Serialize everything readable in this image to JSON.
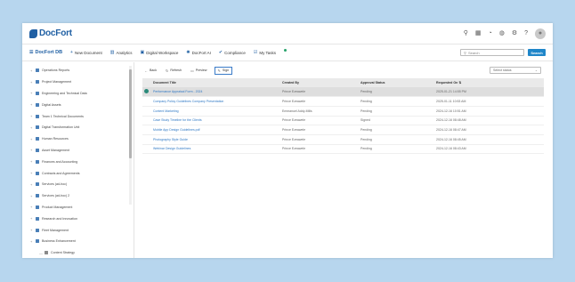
{
  "app": {
    "logo": "DocFort"
  },
  "top_icons": [
    "search-icon",
    "grid-icon",
    "bell-icon",
    "chat-icon",
    "gear-icon",
    "help-icon",
    "user-avatar-icon"
  ],
  "nav": {
    "brand": "DocFort DB",
    "items": [
      {
        "label": "New Document",
        "icon": "plus-icon"
      },
      {
        "label": "Analytics",
        "icon": "chart-icon"
      },
      {
        "label": "Digital Workspace",
        "icon": "workspace-icon"
      },
      {
        "label": "DocFort AI",
        "icon": "ai-icon"
      },
      {
        "label": "Compliance",
        "icon": "compliance-icon"
      },
      {
        "label": "My Tasks",
        "icon": "tasks-icon"
      }
    ],
    "search_placeholder": "Search",
    "search_button": "Search"
  },
  "sidebar": {
    "items": [
      {
        "label": "Operations Reports",
        "child": false
      },
      {
        "label": "Project Management",
        "child": false
      },
      {
        "label": "Engineering and Technical Data",
        "child": false
      },
      {
        "label": "Digital Assets",
        "child": false
      },
      {
        "label": "Team 1 Technical Documents",
        "child": false
      },
      {
        "label": "Digital Transformation Unit",
        "child": false
      },
      {
        "label": "Human Resources",
        "child": false
      },
      {
        "label": "Asset Management",
        "child": false
      },
      {
        "label": "Finances and Accounting",
        "child": false
      },
      {
        "label": "Contracts and Agreements",
        "child": false
      },
      {
        "label": "Services (ad-hoc)",
        "child": false
      },
      {
        "label": "Services (ad-hoc) 2",
        "child": false
      },
      {
        "label": "Product Management",
        "child": false
      },
      {
        "label": "Research and Innovation",
        "child": false
      },
      {
        "label": "Fleet Management",
        "child": false
      },
      {
        "label": "Business Enhancement",
        "child": false
      },
      {
        "label": "Content Strategy",
        "child": true
      }
    ]
  },
  "toolbar": {
    "back": "Back",
    "refresh": "Refresh",
    "preview": "Preview",
    "sign": "Sign",
    "status_placeholder": "Select status"
  },
  "table": {
    "headers": [
      "Document Title",
      "Created By",
      "Approval Status",
      "Requested On"
    ],
    "rows": [
      {
        "title": "Performance Appraisal Form - 2024",
        "created_by": "Prince Ezeawele",
        "status": "Pending",
        "requested_on": "2025-01-21 14:55 PM",
        "selected": true
      },
      {
        "title": "Company Policy Guidelines Company Presentation",
        "created_by": "Prince Ezeawele",
        "status": "Pending",
        "requested_on": "2025-01-11 10:53 AM",
        "selected": false
      },
      {
        "title": "Content Marketing",
        "created_by": "Emmanuel Addy-Mills",
        "status": "Pending",
        "requested_on": "2024-12-16 10:51 AM",
        "selected": false
      },
      {
        "title": "Case Study Timeline for the Clients",
        "created_by": "Prince Ezeawele",
        "status": "Signed",
        "requested_on": "2024-12-16 08:48 AM",
        "selected": false
      },
      {
        "title": "Mobile App Design Guidelines.pdf",
        "created_by": "Prince Ezeawele",
        "status": "Pending",
        "requested_on": "2024-12-16 08:47 AM",
        "selected": false
      },
      {
        "title": "Photography Style Guide",
        "created_by": "Prince Ezeawele",
        "status": "Pending",
        "requested_on": "2024-12-16 08:45 AM",
        "selected": false
      },
      {
        "title": "Webinar Design Guidelines",
        "created_by": "Prince Ezeawele",
        "status": "Pending",
        "requested_on": "2024-12-16 08:43 AM",
        "selected": false
      }
    ]
  }
}
